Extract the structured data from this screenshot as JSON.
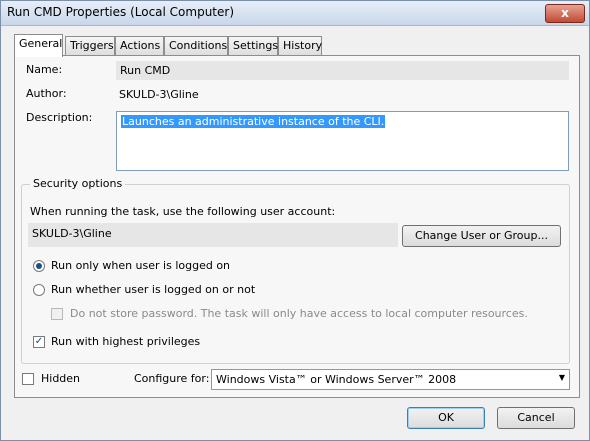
{
  "window": {
    "title": "Run CMD Properties (Local Computer)",
    "close_label": "x"
  },
  "tabs": [
    {
      "label": "General"
    },
    {
      "label": "Triggers"
    },
    {
      "label": "Actions"
    },
    {
      "label": "Conditions"
    },
    {
      "label": "Settings"
    },
    {
      "label": "History"
    }
  ],
  "general": {
    "name_label": "Name:",
    "name_value": "Run CMD",
    "author_label": "Author:",
    "author_value": "SKULD-3\\Gline",
    "description_label": "Description:",
    "description_value": "Launches an administrative instance of the CLI."
  },
  "security": {
    "title": "Security options",
    "account_prompt": "When running the task, use the following user account:",
    "account_value": "SKULD-3\\Gline",
    "change_button": "Change User or Group...",
    "radio_logged_on": "Run only when user is logged on",
    "radio_whether": "Run whether user is logged on or not",
    "no_store_password": "Do not store password.  The task will only have access to local computer resources.",
    "highest_privileges": "Run with highest privileges"
  },
  "footer": {
    "hidden_label": "Hidden",
    "configure_label": "Configure for:",
    "configure_value": "Windows Vista™ or Windows Server™ 2008",
    "ok_label": "OK",
    "cancel_label": "Cancel"
  },
  "state": {
    "active_tab": "General",
    "radio_selected": "logged_on",
    "highest_privileges_checked": true,
    "hidden_checked": false,
    "no_store_password_checked": false
  },
  "icons": {
    "close": "close-icon",
    "dropdown": "chevron-down-icon"
  }
}
